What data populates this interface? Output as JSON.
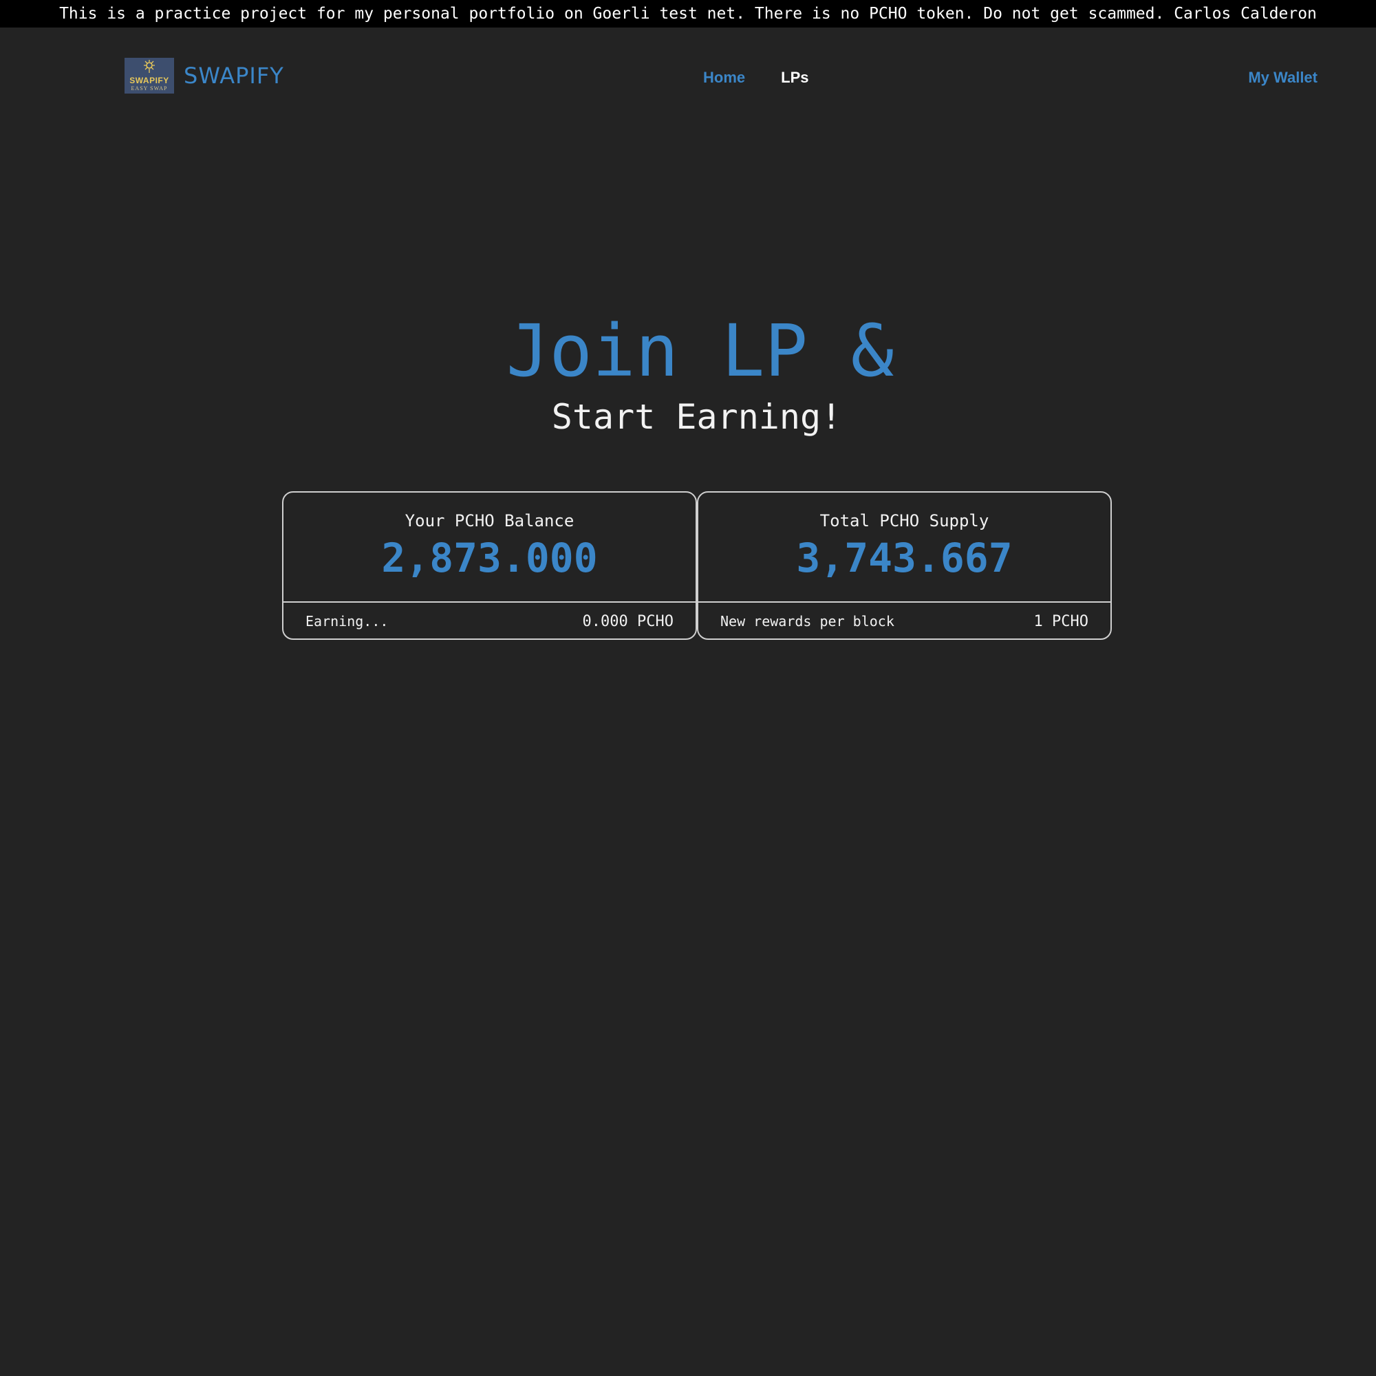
{
  "banner": {
    "text": "This is a practice project for my personal portfolio on Goerli test net. There is no PCHO token. Do not get scammed. Carlos Calderon"
  },
  "header": {
    "logo": {
      "main": "SWAPIFY",
      "sub": "EASY SWAP"
    },
    "brand": "SWAPIFY",
    "nav": {
      "home": "Home",
      "lps": "LPs"
    },
    "wallet": "My Wallet"
  },
  "hero": {
    "title": "Join LP &",
    "subtitle": "Start Earning!"
  },
  "cards": {
    "balance": {
      "label": "Your PCHO Balance",
      "value": "2,873.000",
      "foot_label": "Earning...",
      "foot_value": "0.000 PCHO"
    },
    "supply": {
      "label": "Total PCHO Supply",
      "value": "3,743.667",
      "foot_label": "New rewards per block",
      "foot_value": "1 PCHO"
    }
  },
  "colors": {
    "accent": "#3b86c8",
    "background": "#232323",
    "banner": "#000000"
  }
}
